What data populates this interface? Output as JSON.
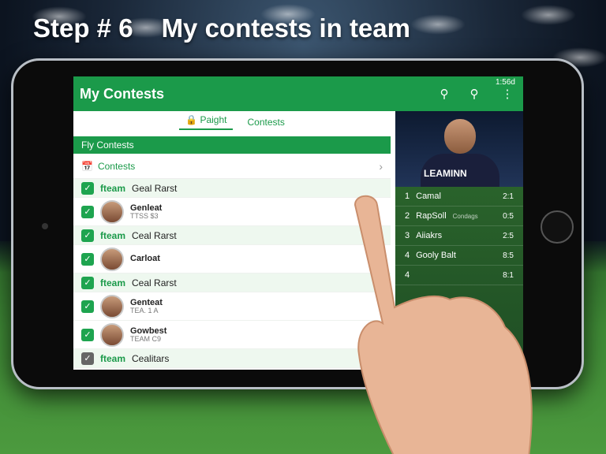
{
  "headline": {
    "step": "Step # 6",
    "title": "My contests in team"
  },
  "appbar": {
    "title": "My Contests",
    "status": "1:56d"
  },
  "tabs": {
    "active": "Paight",
    "other": "Contests"
  },
  "section_head": "Fly Contests",
  "list_head": "Contests",
  "rows": [
    {
      "type": "group",
      "logo": "fteam",
      "label": "Geal Rarst"
    },
    {
      "type": "player",
      "name": "Genleat",
      "sub": "TTSS $3"
    },
    {
      "type": "group",
      "logo": "fteam",
      "label": "Ceal Rarst"
    },
    {
      "type": "player",
      "name": "Carloat",
      "sub": ""
    },
    {
      "type": "group",
      "logo": "fteam",
      "label": "Ceal Rarst"
    },
    {
      "type": "player",
      "name": "Genteat",
      "sub": "TEA. 1 A"
    },
    {
      "type": "player",
      "name": "Gowbest",
      "sub": "TEAM C9"
    },
    {
      "type": "group",
      "logo": "fteam",
      "label": "Cealitars"
    }
  ],
  "hero_label": "LEAMINN",
  "leaderboard": [
    {
      "rank": "1",
      "name": "Camal",
      "sub": "",
      "score": "2:1"
    },
    {
      "rank": "2",
      "name": "RapSoll",
      "sub": "Condags",
      "score": "0:5"
    },
    {
      "rank": "3",
      "name": "Aiiakrs",
      "sub": "",
      "score": "2:5"
    },
    {
      "rank": "4",
      "name": "Gooly Balt",
      "sub": "",
      "score": "8:5"
    },
    {
      "rank": "4",
      "name": "",
      "sub": "",
      "score": "8:1"
    }
  ],
  "colors": {
    "accent": "#1b9a4a",
    "tablet": "#0b0b0b"
  },
  "icons": [
    "search-icon",
    "search-icon",
    "more-vert-icon",
    "lock-icon",
    "calendar-icon",
    "chevron-right-icon"
  ]
}
